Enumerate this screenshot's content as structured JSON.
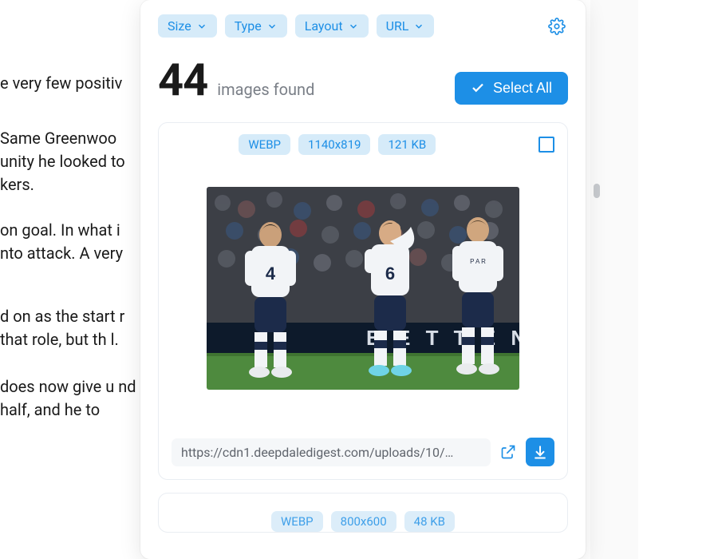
{
  "article": {
    "p1": "e very few positiv",
    "p2": "Same Greenwoo unity he looked to kers.",
    "p3": "on goal. In what i nto attack. A very",
    "p4": "d on as the start r that role, but th l.",
    "p5": " does now give u nd half, and he to"
  },
  "filters": {
    "size": "Size",
    "type": "Type",
    "layout": "Layout",
    "url": "URL"
  },
  "count": {
    "value": "44",
    "label": "images found"
  },
  "select_all": "Select All",
  "card": {
    "format": "WEBP",
    "dims": "1140x819",
    "size": "121 KB",
    "url": "https://cdn1.deepdaledigest.com/uploads/10/…"
  },
  "next_card": {
    "format": "WEBP",
    "dims": "800x600",
    "size": "48 KB"
  }
}
